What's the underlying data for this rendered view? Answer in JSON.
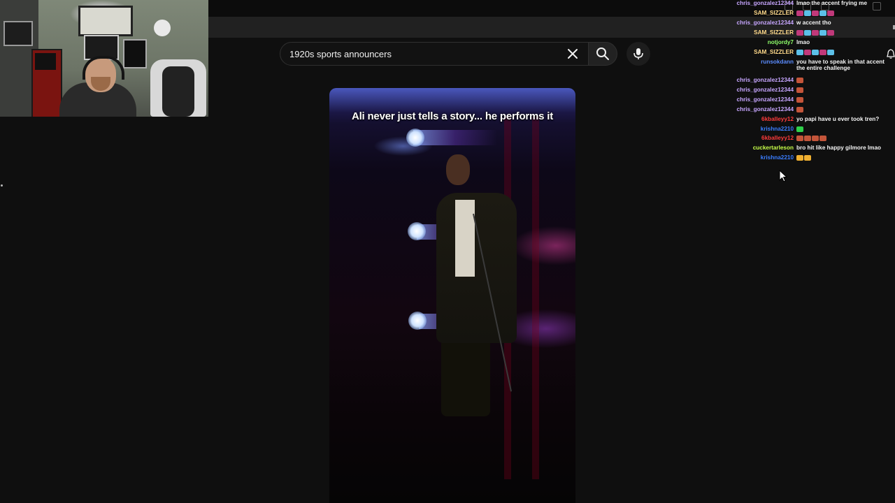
{
  "search": {
    "query": "1920s sports announcers"
  },
  "video": {
    "caption": "Ali never just tells a story... he performs it"
  },
  "chat": {
    "messages": [
      {
        "user": "chris_gonzalez12344",
        "color": "#c7a6ff",
        "text": "lmao the accent frying me"
      },
      {
        "user": "SAM_SIZZLER",
        "color": "#ffd98a",
        "text": "",
        "emotes": [
          "#c0397a",
          "#5cc0e8",
          "#c0397a",
          "#5cc0e8",
          "#c0397a"
        ]
      },
      {
        "user": "chris_gonzalez12344",
        "color": "#c7a6ff",
        "text": "w accent tho"
      },
      {
        "user": "SAM_SIZZLER",
        "color": "#ffd98a",
        "text": "",
        "emotes": [
          "#c0397a",
          "#5cc0e8",
          "#c0397a",
          "#5cc0e8",
          "#c0397a"
        ]
      },
      {
        "user": "notjordy7",
        "color": "#8fff6a",
        "text": "lmao"
      },
      {
        "user": "SAM_SIZZLER",
        "color": "#ffd98a",
        "text": "",
        "emotes": [
          "#5cc0e8",
          "#c0397a",
          "#5cc0e8",
          "#c0397a",
          "#5cc0e8"
        ]
      },
      {
        "user": "runsokdann",
        "color": "#5b8cff",
        "text": "you have to speak in that accent the entire challenge"
      },
      {
        "user": "chris_gonzalez12344",
        "color": "#c7a6ff",
        "text": "",
        "emotes": [
          "#c4553a"
        ]
      },
      {
        "user": "chris_gonzalez12344",
        "color": "#c7a6ff",
        "text": "",
        "emotes": [
          "#c4553a"
        ]
      },
      {
        "user": "chris_gonzalez12344",
        "color": "#c7a6ff",
        "text": "",
        "emotes": [
          "#c4553a"
        ]
      },
      {
        "user": "chris_gonzalez12344",
        "color": "#c7a6ff",
        "text": "",
        "emotes": [
          "#c4553a"
        ]
      },
      {
        "user": "6kballeyy12",
        "color": "#ff3b3b",
        "text": "yo papi have u ever took tren?"
      },
      {
        "user": "krishna2210",
        "color": "#3b7dff",
        "text": "",
        "emotes": [
          "#2fd04a"
        ]
      },
      {
        "user": "6kballeyy12",
        "color": "#ff3b3b",
        "text": "",
        "emotes": [
          "#c4553a",
          "#c4553a",
          "#c4553a",
          "#c4553a"
        ]
      },
      {
        "user": "cuckertarleson",
        "color": "#c8ff4a",
        "text": "bro hit like happy gilmore lmao"
      },
      {
        "user": "krishna2210",
        "color": "#3b7dff",
        "text": "",
        "emotes": [
          "#f0b030",
          "#f0b030"
        ]
      }
    ]
  },
  "icons": {
    "clear": "close-icon",
    "search": "search-icon",
    "mic": "microphone-icon",
    "bell": "bell-icon",
    "cursor": "mouse-cursor-icon"
  },
  "colors": {
    "background": "#0f0f0f",
    "search_border": "#303030",
    "search_button": "#222222"
  }
}
